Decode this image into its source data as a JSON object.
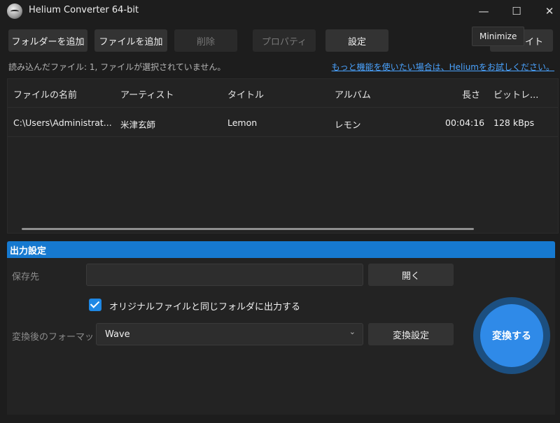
{
  "window": {
    "title": "Helium Converter 64-bit",
    "minimize_glyph": "—",
    "maximize_glyph": "☐",
    "close_glyph": "✕",
    "tooltip": "Minimize"
  },
  "toolbar": {
    "add_folder": "フォルダーを追加",
    "add_file": "ファイルを追加",
    "delete": "削除",
    "properties": "プロパティ",
    "settings": "設定",
    "partial_button": "サイト"
  },
  "status": {
    "loaded_text": "読み込んだファイル: 1, ファイルが選択されていません。",
    "promo_link": "もっと機能を使いたい場合は、Heliumをお試しください。"
  },
  "table": {
    "columns": [
      "ファイルの名前",
      "アーティスト",
      "タイトル",
      "アルバム",
      "長さ",
      "ビットレ..."
    ],
    "rows": [
      [
        "C:\\Users\\Administrat...",
        "米津玄師",
        "Lemon",
        "レモン",
        "00:04:16",
        "128 kBps"
      ]
    ]
  },
  "output": {
    "header": "出力設定",
    "save_to_label": "保存先",
    "save_to_value": "",
    "open_button": "開く",
    "same_folder_checkbox": "オリジナルファイルと同じフォルダに出力する",
    "same_folder_checked": true,
    "format_label": "変換後のフォーマット:",
    "format_value": "Wave",
    "convert_settings_button": "変換設定",
    "convert_button": "変換する"
  },
  "colors": {
    "accent": "#1679d0",
    "link": "#4aa3ff",
    "background": "#1d1d1d"
  }
}
